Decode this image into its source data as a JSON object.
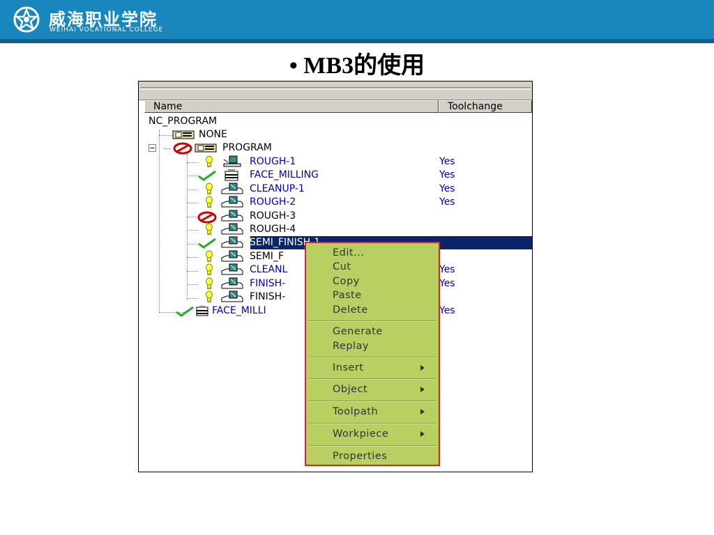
{
  "header": {
    "college_name": "威海职业学院",
    "college_sub": "WEIHAI VOCATIONAL COLLEGE"
  },
  "slide": {
    "title": "• MB3的使用"
  },
  "columns": {
    "name": "Name",
    "toolchange": "Toolchange"
  },
  "tree": {
    "root": "NC_PROGRAM",
    "none": "NONE",
    "program": "PROGRAM",
    "ops": [
      {
        "label": "ROUGH-1",
        "toolchange": "Yes",
        "status": "bulb",
        "icon": "mill-op-icon"
      },
      {
        "label": "FACE_MILLING",
        "toolchange": "Yes",
        "status": "check",
        "icon": "face-mill-icon"
      },
      {
        "label": "CLEANUP-1",
        "toolchange": "Yes",
        "status": "bulb",
        "icon": "operation-icon"
      },
      {
        "label": "ROUGH-2",
        "toolchange": "Yes",
        "status": "bulb",
        "icon": "operation-icon"
      },
      {
        "label": "ROUGH-3",
        "toolchange": "",
        "status": "no",
        "icon": "operation-icon"
      },
      {
        "label": "ROUGH-4",
        "toolchange": "",
        "status": "bulb",
        "icon": "operation-icon"
      },
      {
        "label": "SEMI_FINISH-1",
        "toolchange": "",
        "status": "check",
        "icon": "operation-icon",
        "selected": true
      },
      {
        "label": "SEMI_F",
        "toolchange": "",
        "status": "bulb",
        "icon": "operation-icon"
      },
      {
        "label": "CLEANL",
        "toolchange": "Yes",
        "status": "bulb",
        "icon": "operation-icon"
      },
      {
        "label": "FINISH-",
        "toolchange": "Yes",
        "status": "bulb",
        "icon": "operation-icon"
      },
      {
        "label": "FINISH-",
        "toolchange": "",
        "status": "bulb",
        "icon": "operation-icon"
      }
    ],
    "last": {
      "label": "FACE_MILLI",
      "toolchange": "Yes"
    }
  },
  "context_menu": {
    "edit": "Edit...",
    "cut": "Cut",
    "copy": "Copy",
    "paste": "Paste",
    "delete": "Delete",
    "generate": "Generate",
    "replay": "Replay",
    "insert": "Insert",
    "object": "Object",
    "toolpath": "Toolpath",
    "workpiece": "Workpiece",
    "properties": "Properties"
  },
  "colors": {
    "banner": "#1a86be",
    "menu_bg": "#b9cf62",
    "menu_border": "#d3281f",
    "selection": "#0a246a",
    "op_text": "#0000cc"
  }
}
